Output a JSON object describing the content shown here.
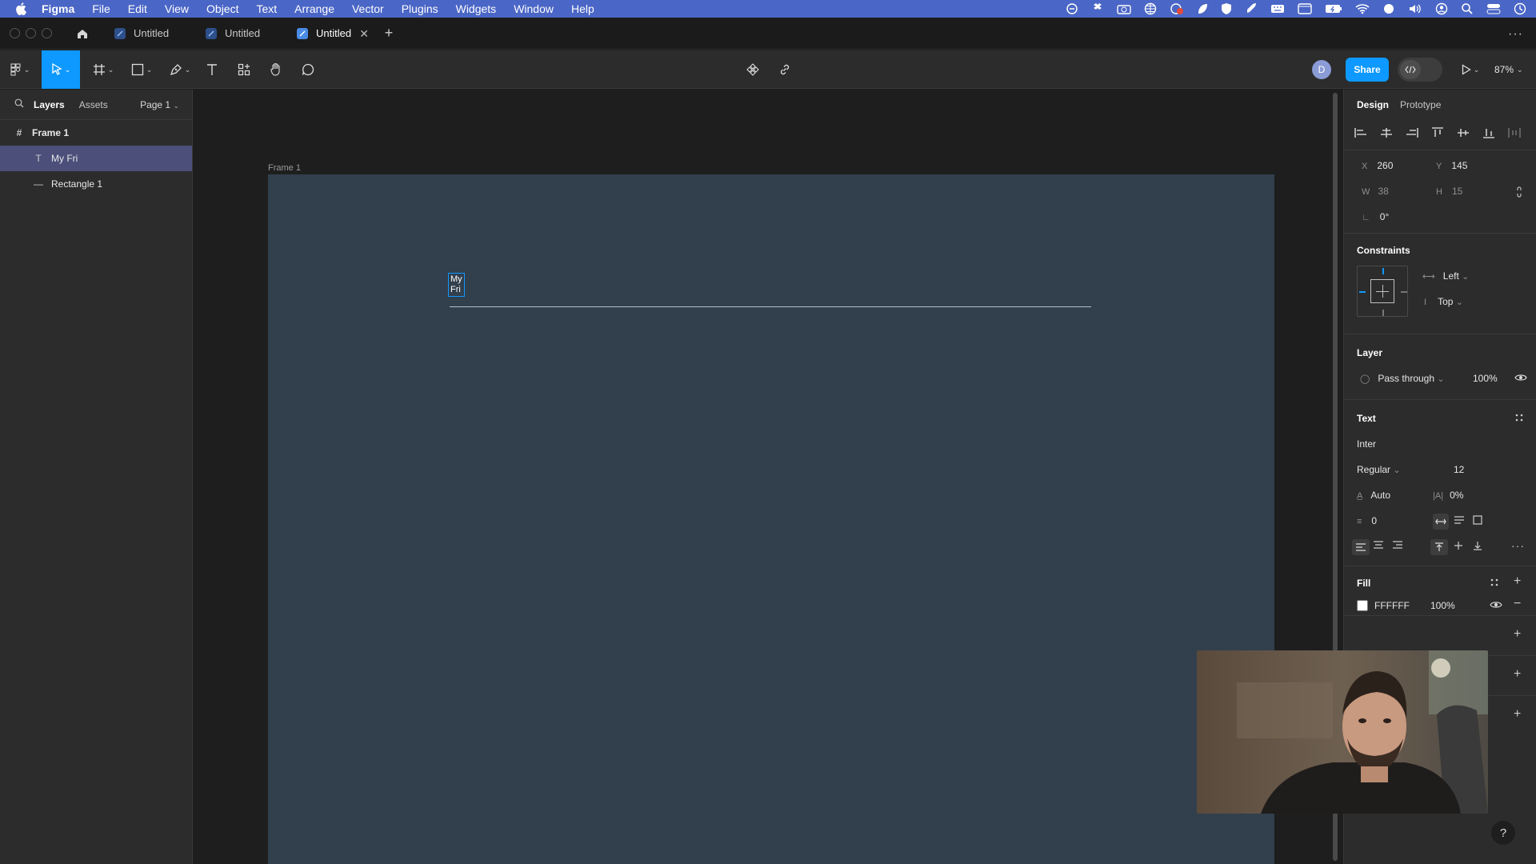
{
  "menubar": {
    "app_name": "Figma",
    "items": [
      "File",
      "Edit",
      "View",
      "Object",
      "Text",
      "Arrange",
      "Vector",
      "Plugins",
      "Widgets",
      "Window",
      "Help"
    ],
    "status_icons": [
      "sync-icon",
      "dropbox-icon",
      "camera-icon",
      "globe-icon",
      "record-icon",
      "leaf-icon",
      "shield-icon",
      "rocket-icon",
      "keyboard-icon",
      "window-icon",
      "battery-icon",
      "wifi-icon",
      "dot-icon",
      "volume-icon",
      "user-icon",
      "search-icon",
      "control-center-icon",
      "clock-icon"
    ]
  },
  "tabs": {
    "items": [
      {
        "label": "Untitled",
        "active": false
      },
      {
        "label": "Untitled",
        "active": false
      },
      {
        "label": "Untitled",
        "active": true
      }
    ],
    "add": "+",
    "more": "···"
  },
  "toolbar": {
    "avatar_initial": "D",
    "share_label": "Share",
    "zoom": "87%"
  },
  "left_panel": {
    "tab_layers": "Layers",
    "tab_assets": "Assets",
    "page": "Page 1",
    "layers": [
      {
        "name": "Frame 1",
        "type": "frame"
      },
      {
        "name": "My Fri",
        "type": "text",
        "selected": true
      },
      {
        "name": "Rectangle 1",
        "type": "line"
      }
    ]
  },
  "canvas": {
    "frame_label": "Frame 1",
    "text_content": "My Fri"
  },
  "right_panel": {
    "tab_design": "Design",
    "tab_prototype": "Prototype",
    "x_label": "X",
    "x_value": "260",
    "y_label": "Y",
    "y_value": "145",
    "w_label": "W",
    "w_value": "38",
    "h_label": "H",
    "h_value": "15",
    "rotation": "0°",
    "constraints_title": "Constraints",
    "constraint_h": "Left",
    "constraint_v": "Top",
    "layer_title": "Layer",
    "blend_mode": "Pass through",
    "layer_opacity": "100%",
    "text_title": "Text",
    "font_family": "Inter",
    "font_weight": "Regular",
    "font_size": "12",
    "line_height": "Auto",
    "letter_spacing": "0%",
    "paragraph_spacing": "0",
    "fill_title": "Fill",
    "fill_hex": "FFFFFF",
    "fill_opacity": "100%"
  },
  "colors": {
    "accent": "#0d99ff",
    "frame_fill": "#323f4c",
    "selected_layer": "#4b4f7a",
    "menubar": "#4a66c6"
  }
}
